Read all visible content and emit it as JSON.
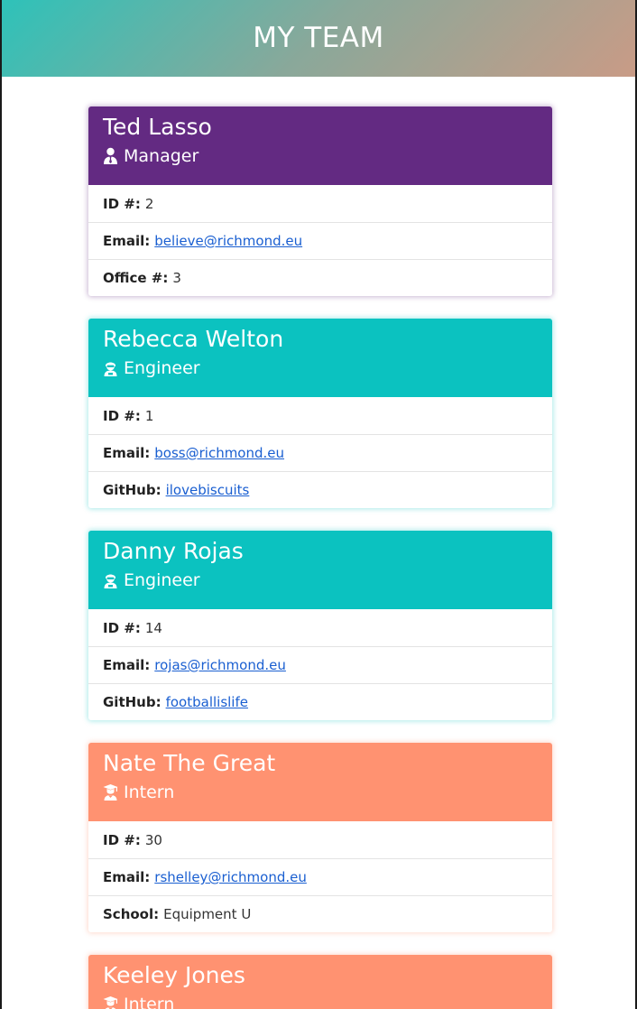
{
  "header": {
    "title": "MY TEAM"
  },
  "colors": {
    "manager": "#632a82",
    "engineer": "#0bc2c0",
    "intern": "#ff9271",
    "link": "#1a5fd1"
  },
  "cards": [
    {
      "name": "Ted Lasso",
      "role": "Manager",
      "role_icon": "manager-icon",
      "id_label": "ID #:",
      "id_value": "2",
      "email_label": "Email:",
      "email_value": "believe@richmond.eu",
      "extra_label": "Office #:",
      "extra_value": "3"
    },
    {
      "name": "Rebecca Welton",
      "role": "Engineer",
      "role_icon": "engineer-icon",
      "id_label": "ID #:",
      "id_value": "1",
      "email_label": "Email:",
      "email_value": "boss@richmond.eu",
      "extra_label": "GitHub:",
      "extra_value": "ilovebiscuits"
    },
    {
      "name": "Danny Rojas",
      "role": "Engineer",
      "role_icon": "engineer-icon",
      "id_label": "ID #:",
      "id_value": "14",
      "email_label": "Email:",
      "email_value": "rojas@richmond.eu",
      "extra_label": "GitHub:",
      "extra_value": "footballislife"
    },
    {
      "name": "Nate The Great",
      "role": "Intern",
      "role_icon": "intern-icon",
      "id_label": "ID #:",
      "id_value": "30",
      "email_label": "Email:",
      "email_value": "rshelley@richmond.eu",
      "extra_label": "School:",
      "extra_value": "Equipment U"
    },
    {
      "name": "Keeley Jones",
      "role": "Intern",
      "role_icon": "intern-icon"
    }
  ]
}
